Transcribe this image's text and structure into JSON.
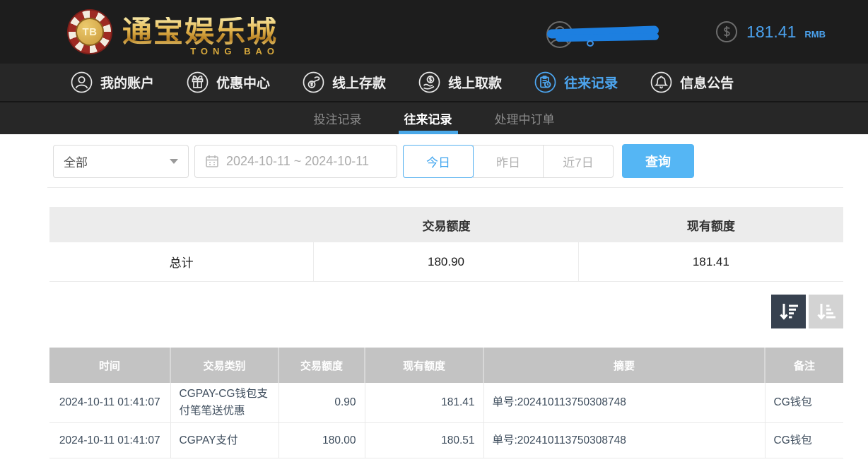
{
  "brand": {
    "chip": "TB",
    "name_cn": "通宝娱乐城",
    "name_en": "TONG BAO"
  },
  "account": {
    "balance": "181.41",
    "currency": "RMB"
  },
  "nav": {
    "items": [
      {
        "label": "我的账户",
        "icon": "user-icon"
      },
      {
        "label": "优惠中心",
        "icon": "gift-icon"
      },
      {
        "label": "线上存款",
        "icon": "deposit-icon"
      },
      {
        "label": "线上取款",
        "icon": "withdraw-icon"
      },
      {
        "label": "往来记录",
        "icon": "records-icon"
      },
      {
        "label": "信息公告",
        "icon": "announcement-icon"
      }
    ],
    "active": "往来记录"
  },
  "tabs": {
    "bet_records": "投注记录",
    "transaction_records": "往来记录",
    "pending_orders": "处理中订单",
    "active": "往来记录"
  },
  "filters": {
    "type_selected": "全部",
    "date_range": "2024-10-11 ~ 2024-10-11",
    "quick_today": "今日",
    "quick_yesterday": "昨日",
    "quick_7days": "近7日",
    "search_label": "查询"
  },
  "summary": {
    "col_trade": "交易额度",
    "col_balance": "现有额度",
    "total_label": "总计",
    "trade_total": "180.90",
    "balance_total": "181.41"
  },
  "table": {
    "headers": {
      "time": "时间",
      "category": "交易类别",
      "amount": "交易额度",
      "balance": "现有额度",
      "summary": "摘要",
      "note": "备注"
    },
    "rows": [
      {
        "time": "2024-10-11 01:41:07",
        "category": "CGPAY-CG钱包支付笔笔送优惠",
        "amount": "0.90",
        "balance": "181.41",
        "summary": "单号:202410113750308748",
        "note": "CG钱包"
      },
      {
        "time": "2024-10-11 01:41:07",
        "category": "CGPAY支付",
        "amount": "180.00",
        "balance": "180.51",
        "summary": "单号:202410113750308748",
        "note": "CG钱包"
      }
    ]
  },
  "colors": {
    "accent_blue": "#55b6f4",
    "nav_active_blue": "#4da6f0",
    "scribble_blue": "#1d7fe0",
    "header_bg": "#1d1d1d",
    "table_header_bg": "#c3c3c3",
    "sort_dark": "#37414f"
  }
}
